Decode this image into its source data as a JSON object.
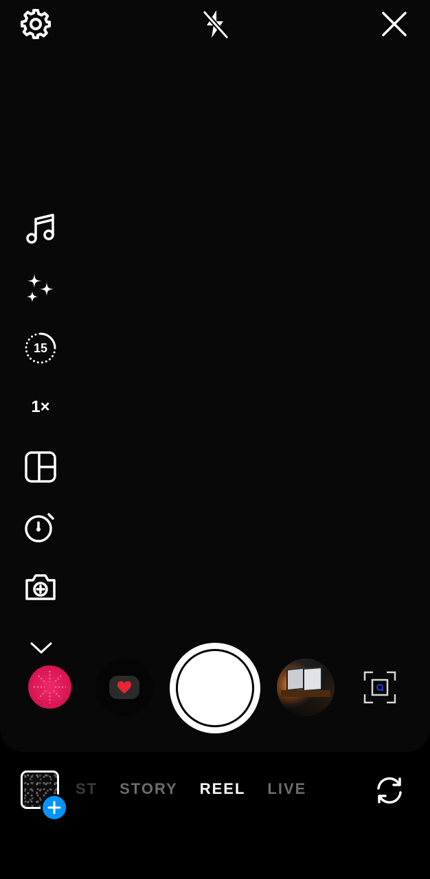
{
  "top_bar": {
    "settings_icon": "gear-icon",
    "flash_icon": "flash-off-icon",
    "close_icon": "close-icon"
  },
  "side_tools": {
    "audio_icon": "music-note-icon",
    "effects_icon": "sparkles-icon",
    "length_label": "15",
    "speed_label": "1×",
    "layout_icon": "layout-grid-icon",
    "timer_icon": "timer-icon",
    "dual_icon": "dual-camera-icon",
    "more_icon": "chevron-down-icon"
  },
  "effects_tray": {
    "items": [
      "pink-burst-effect",
      "heart-effect",
      "photo-effect"
    ],
    "scan_icon": "scan-frame-icon"
  },
  "modes": {
    "items": [
      "ST",
      "STORY",
      "REEL",
      "LIVE"
    ],
    "active": "REEL"
  },
  "gallery": {
    "add_icon": "plus-icon",
    "flip_icon": "flip-camera-icon"
  },
  "colors": {
    "accent": "#0095f6",
    "effect_pink": "#d6144f",
    "background": "#000000"
  }
}
